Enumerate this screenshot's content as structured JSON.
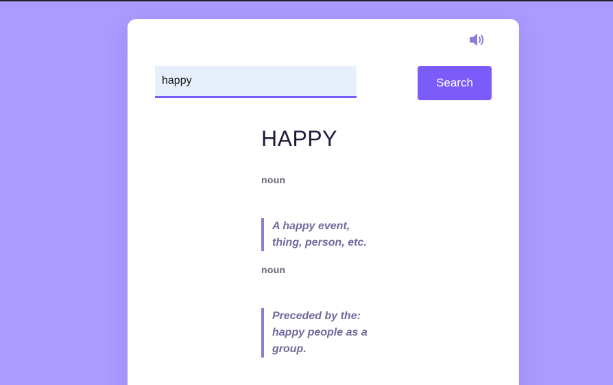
{
  "search": {
    "value": "happy",
    "button_label": "Search"
  },
  "result": {
    "word": "HAPPY",
    "meanings": [
      {
        "part_of_speech": "noun",
        "definition": "A happy event, thing, person, etc."
      },
      {
        "part_of_speech": "noun",
        "definition": "Preceded by the: happy people as a group."
      }
    ]
  },
  "icons": {
    "speaker": "speaker-volume-icon"
  },
  "colors": {
    "background": "#ab9bff",
    "accent": "#7b5cfa",
    "input_background": "#e8effc",
    "definition_border": "#8f79d6"
  }
}
